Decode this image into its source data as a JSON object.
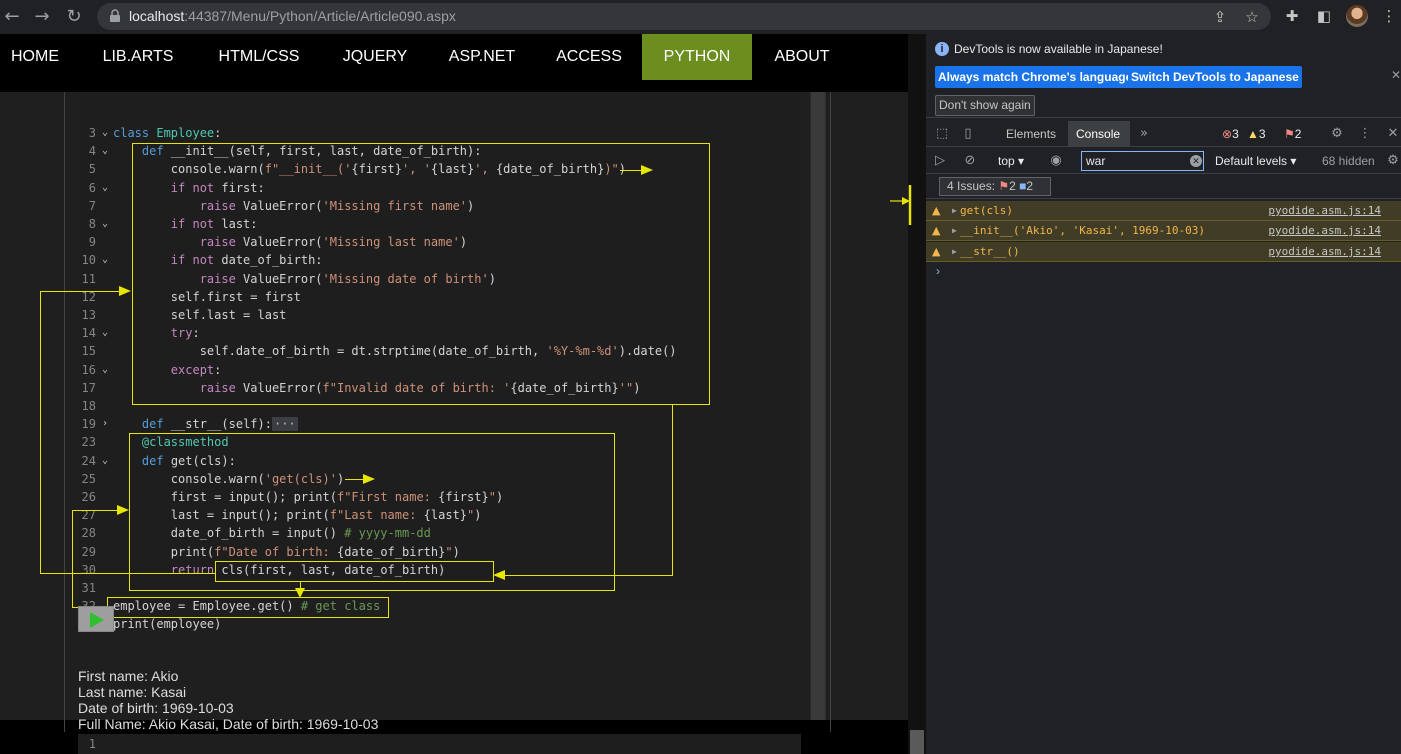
{
  "browser": {
    "url_host": "localhost",
    "url_rest": ":44387/Menu/Python/Article/Article090.aspx"
  },
  "site_nav": {
    "items": [
      "HOME",
      "LIB.ARTS",
      "HTML/CSS",
      "JQUERY",
      "ASP.NET",
      "ACCESS",
      "PYTHON",
      "ABOUT"
    ],
    "active": "PYTHON",
    "active_color": "#6b8e1e"
  },
  "code_lines": [
    {
      "n": "3",
      "fold": "⌄",
      "html": "<span class=\"kw2\">class</span> <span class=\"cls\">Employee</span>:"
    },
    {
      "n": "4",
      "fold": "⌄",
      "html": "    <span class=\"kw2\">def</span> __init__(self, first, last, date_of_birth):"
    },
    {
      "n": "5",
      "fold": "",
      "html": "        console.warn(<span class=\"str\">f\"__init__('</span>{first}<span class=\"str\">', '</span>{last}<span class=\"str\">', </span>{date_of_birth}<span class=\"str\">)\"</span>)"
    },
    {
      "n": "6",
      "fold": "⌄",
      "html": "        <span class=\"kw\">if not</span> first:"
    },
    {
      "n": "7",
      "fold": "",
      "html": "            <span class=\"kw\">raise</span> ValueError(<span class=\"str\">'Missing first name'</span>)"
    },
    {
      "n": "8",
      "fold": "⌄",
      "html": "        <span class=\"kw\">if not</span> last:"
    },
    {
      "n": "9",
      "fold": "",
      "html": "            <span class=\"kw\">raise</span> ValueError(<span class=\"str\">'Missing last name'</span>)"
    },
    {
      "n": "10",
      "fold": "⌄",
      "html": "        <span class=\"kw\">if not</span> date_of_birth:"
    },
    {
      "n": "11",
      "fold": "",
      "html": "            <span class=\"kw\">raise</span> ValueError(<span class=\"str\">'Missing date of birth'</span>)"
    },
    {
      "n": "12",
      "fold": "",
      "html": "        self.first = first"
    },
    {
      "n": "13",
      "fold": "",
      "html": "        self.last = last"
    },
    {
      "n": "14",
      "fold": "⌄",
      "html": "        <span class=\"kw\">try</span>:"
    },
    {
      "n": "15",
      "fold": "",
      "html": "            self.date_of_birth = dt.strptime(date_of_birth, <span class=\"str\">'%Y-%m-%d'</span>).date()"
    },
    {
      "n": "16",
      "fold": "⌄",
      "html": "        <span class=\"kw\">except</span>:"
    },
    {
      "n": "17",
      "fold": "",
      "html": "            <span class=\"kw\">raise</span> ValueError(<span class=\"str\">f\"Invalid date of birth: '</span>{date_of_birth}<span class=\"str\">'\"</span>)"
    },
    {
      "n": "18",
      "fold": "",
      "html": ""
    },
    {
      "n": "19",
      "fold": "›",
      "html": "    <span class=\"kw2\">def</span> __str__(self):<span style=\"background:#3a3d41;color:#bbb;padding:0 2px\">···</span>"
    },
    {
      "n": "23",
      "fold": "",
      "html": "    <span class=\"cls\">@classmethod</span>"
    },
    {
      "n": "24",
      "fold": "⌄",
      "html": "    <span class=\"kw2\">def</span> get(cls):"
    },
    {
      "n": "25",
      "fold": "",
      "html": "        console.warn(<span class=\"str\">'get(cls)'</span>)"
    },
    {
      "n": "26",
      "fold": "",
      "html": "        first = input(); print(<span class=\"str\">f\"First name: </span>{first}<span class=\"str\">\"</span>)"
    },
    {
      "n": "27",
      "fold": "",
      "html": "        last = input(); print(<span class=\"str\">f\"Last name: </span>{last}<span class=\"str\">\"</span>)"
    },
    {
      "n": "28",
      "fold": "",
      "html": "        date_of_birth = input() <span class=\"cm\"># yyyy-mm-dd</span>"
    },
    {
      "n": "29",
      "fold": "",
      "html": "        print(<span class=\"str\">f\"Date of birth: </span>{date_of_birth}<span class=\"str\">\"</span>)"
    },
    {
      "n": "30",
      "fold": "",
      "html": "        <span class=\"kw\">return</span> cls(first, last, date_of_birth)"
    },
    {
      "n": "31",
      "fold": "",
      "html": ""
    },
    {
      "n": "32",
      "fold": "",
      "html": "employee = Employee.get() <span class=\"cm\"># get class</span>"
    },
    {
      "n": "33",
      "fold": "",
      "html": "print(employee)"
    }
  ],
  "output": {
    "lines": [
      "First name: Akio",
      "Last name: Kasai",
      "Date of birth: 1969-10-03",
      "Full Name: Akio Kasai, Date of birth: 1969-10-03"
    ]
  },
  "editor2": {
    "line_number": "1"
  },
  "devtools": {
    "banner_message": "DevTools is now available in Japanese!",
    "btn_match": "Always match Chrome's language",
    "btn_switch": "Switch DevTools to Japanese",
    "btn_dont_show": "Don't show again",
    "tabs": {
      "elements": "Elements",
      "console": "Console"
    },
    "errors_count": "3",
    "warnings_count": "3",
    "issues_count": "2",
    "context": "top",
    "filter_value": "war",
    "levels": "Default levels",
    "hidden": "68 hidden",
    "issues_label": "4 Issues:",
    "issues_red": "2",
    "issues_blue": "2",
    "messages": [
      {
        "text": "get(cls)",
        "source": "pyodide.asm.js:14"
      },
      {
        "text": "__init__('Akio', 'Kasai', 1969-10-03)",
        "source": "pyodide.asm.js:14"
      },
      {
        "text": "__str__()",
        "source": "pyodide.asm.js:14"
      }
    ],
    "accent": "#1a73e8",
    "warn_bg": "#413c26",
    "warn_text": "#f2b64a"
  },
  "annotation_color": "#e6e600"
}
